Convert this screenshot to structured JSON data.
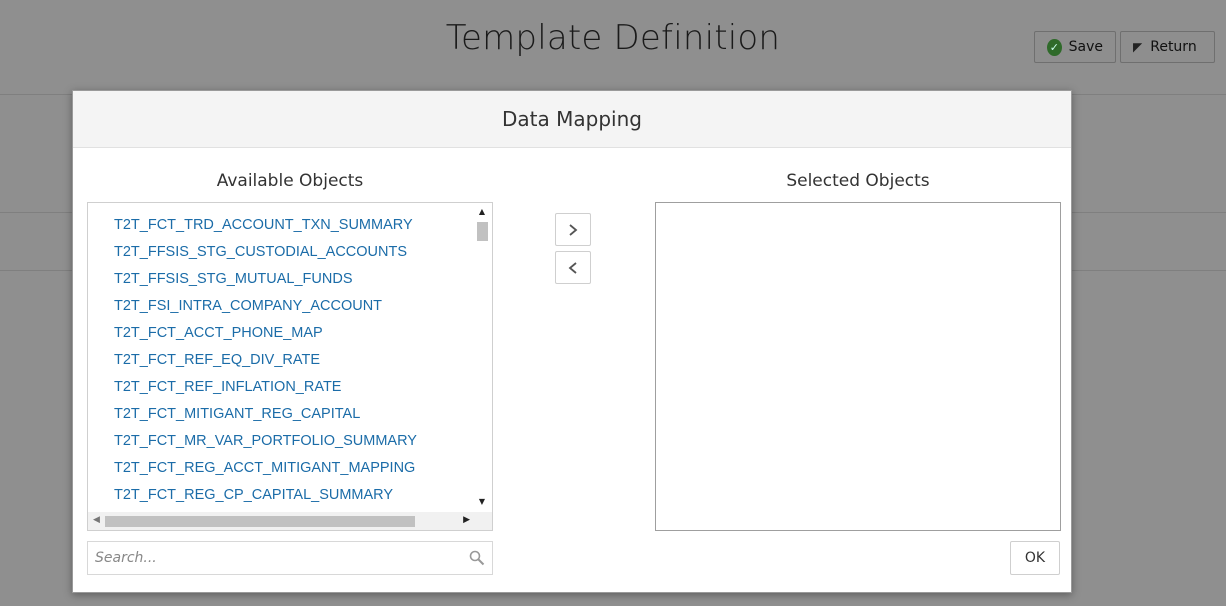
{
  "page": {
    "title": "Template Definition",
    "save_label": "Save",
    "return_label": "Return"
  },
  "dialog": {
    "title": "Data Mapping",
    "available_title": "Available Objects",
    "selected_title": "Selected Objects",
    "available_items": [
      "T2T_FCT_TRD_ACCOUNT_TXN_SUMMARY",
      "T2T_FFSIS_STG_CUSTODIAL_ACCOUNTS",
      "T2T_FFSIS_STG_MUTUAL_FUNDS",
      "T2T_FSI_INTRA_COMPANY_ACCOUNT",
      "T2T_FCT_ACCT_PHONE_MAP",
      "T2T_FCT_REF_EQ_DIV_RATE",
      "T2T_FCT_REF_INFLATION_RATE",
      "T2T_FCT_MITIGANT_REG_CAPITAL",
      "T2T_FCT_MR_VAR_PORTFOLIO_SUMMARY",
      "T2T_FCT_REG_ACCT_MITIGANT_MAPPING",
      "T2T_FCT_REG_CP_CAPITAL_SUMMARY"
    ],
    "selected_items": [],
    "search_placeholder": "Search...",
    "ok_label": "OK"
  },
  "icons": {
    "save": "check-circle-icon",
    "return": "flag-icon",
    "move_right": "chevron-right-icon",
    "move_left": "chevron-left-icon",
    "search": "search-icon"
  },
  "colors": {
    "link": "#1b6ca8",
    "overlay": "#8f8f8f"
  }
}
